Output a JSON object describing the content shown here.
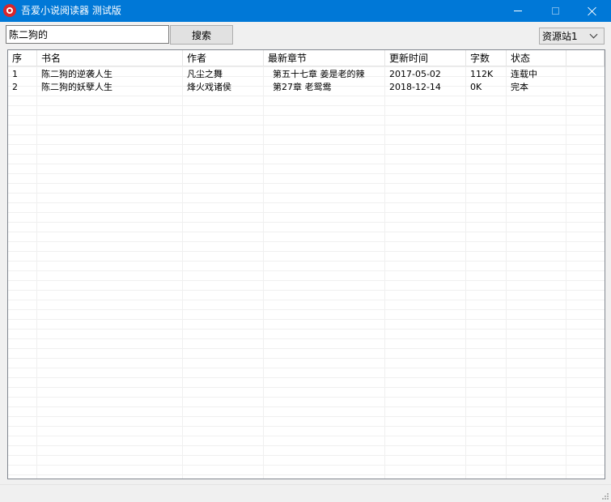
{
  "window": {
    "title": "吾爱小说阅读器 测试版",
    "accent": "#0078d7"
  },
  "toolbar": {
    "search_value": "陈二狗的",
    "search_label": "搜索",
    "source_selected": "资源站1"
  },
  "table": {
    "columns": [
      "序",
      "书名",
      "作者",
      "最新章节",
      "更新时间",
      "字数",
      "状态"
    ],
    "rows": [
      {
        "index": "1",
        "title": "陈二狗的逆袭人生",
        "author": "凡尘之舞",
        "latest_chapter": "第五十七章 姜是老的辣",
        "updated": "2017-05-02",
        "words": "112K",
        "status": "连载中"
      },
      {
        "index": "2",
        "title": "陈二狗的妖孽人生",
        "author": "烽火戏诸侯",
        "latest_chapter": "第27章 老鸳鸯",
        "updated": "2018-12-14",
        "words": "0K",
        "status": "完本"
      }
    ]
  },
  "icons": {
    "app": "app-icon",
    "minimize": "minimize-icon",
    "maximize": "maximize-icon",
    "close": "close-icon",
    "dropdown": "chevron-down-icon"
  }
}
